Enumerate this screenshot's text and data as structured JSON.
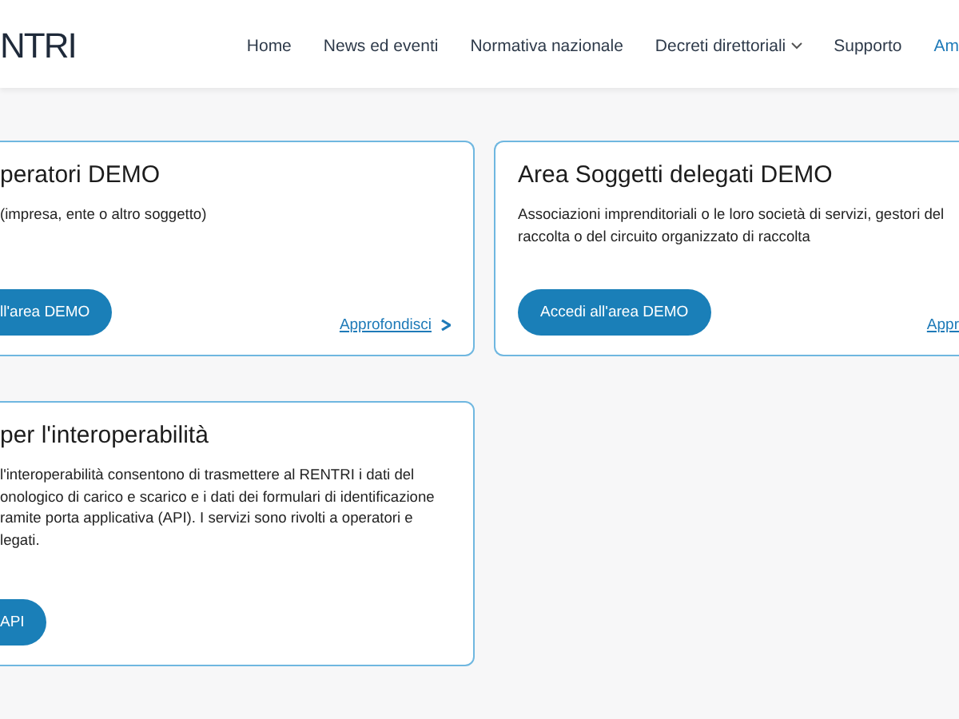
{
  "header": {
    "logo": "NTRI",
    "nav": [
      {
        "label": "Home",
        "selected": false,
        "dropdown": false
      },
      {
        "label": "News ed eventi",
        "selected": false,
        "dropdown": false
      },
      {
        "label": "Normativa nazionale",
        "selected": false,
        "dropdown": false
      },
      {
        "label": "Decreti direttoriali",
        "selected": false,
        "dropdown": true
      },
      {
        "label": "Supporto",
        "selected": false,
        "dropdown": false
      },
      {
        "label": "Am",
        "selected": true,
        "dropdown": false
      }
    ]
  },
  "cards": [
    {
      "title": "peratori DEMO",
      "lines": [
        "(impresa, ente o altro soggetto)"
      ],
      "button": "ll'area DEMO",
      "link": "Approfondisci",
      "kind": "left"
    },
    {
      "title": "Area Soggetti delegati DEMO",
      "lines": [
        "Associazioni imprenditoriali o le loro società di servizi, gestori del",
        "raccolta o del circuito organizzato di raccolta"
      ],
      "button": "Accedi all'area DEMO",
      "link": "Appr",
      "kind": "right"
    },
    {
      "title": "per l'interoperabilità",
      "lines": [
        "l'interoperabilità consentono di trasmettere al RENTRI i dati del",
        "onologico di carico e scarico e i dati dei formulari di identificazione",
        "ramite porta applicativa (API). I servizi sono rivolti a operatori e",
        "legati."
      ],
      "button": "API",
      "kind": "left"
    }
  ]
}
